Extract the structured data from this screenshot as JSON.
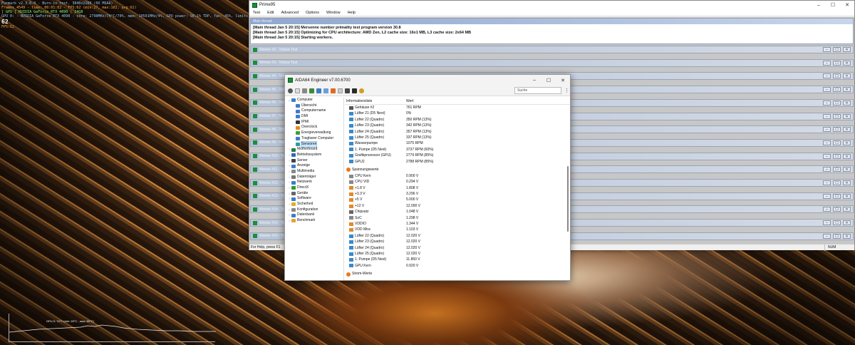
{
  "osd": {
    "line1": "Furmark v2.3.0.0 - Burn-in test, 3840x2160 (0X MSAA)",
    "line2": "Frames 4549 - time: 00:01:02 - FPS:62 (min:27, max:102, avg:62)",
    "line3": "[ GPU ] NVIDIA GeForce RTX 4090 | 24GB",
    "line4": "GPU 0: - NVIDIA GeForce RTX 4090 - core: 2790MHz/74°C/70%, mem: 10501MHz/4%, GPU power: 98.1% TDP, fan: 45%, limits:[power:0, temp:0, volt:0, OV:0]",
    "big": "62",
    "sub": "FPS:62",
    "graph": "GPU 0: 74°C (min: 28°C - max: 80°C)"
  },
  "prime": {
    "title": "Prime95",
    "menu": [
      "Test",
      "Edit",
      "Advanced",
      "Options",
      "Window",
      "Help"
    ],
    "main_title": "Main thread",
    "log": [
      "[Main thread Jan 5 20:15] Mersenne number primality test program version 30.8",
      "[Main thread Jan 5 20:15] Optimizing for CPU architecture: AMD Zen, L2 cache size: 16x1 MB, L3 cache size: 2x64 MB",
      "[Main thread Jan 5 20:15] Starting workers."
    ],
    "workers": [
      "Worker #2 - Torture Test",
      "Worker #3 - Torture Test",
      "Worker #4 - Torture Test",
      "Worker #5 - Torture Test",
      "Worker #6 - Torture Test",
      "Worker #7 - Torture Test",
      "Worker #8 - Torture Test",
      "Worker #9 - Torture Test",
      "Worker #10 - Torture Test",
      "Worker #11 - Torture Test",
      "Worker #12 - Torture Test",
      "Worker #13 - Torture Test",
      "Worker #14 - Torture Test",
      "Worker #15 - Torture Test",
      "Worker #16 - Torture Test"
    ],
    "status": "For Help, press F1",
    "num": "NUM"
  },
  "aida": {
    "title": "AIDA64 Engineer v7.00.6700",
    "search": "Suche",
    "col1": "Informationsliste",
    "col2": "Wert",
    "tree": [
      {
        "label": "Computer",
        "lvl": 0,
        "arrow": "⌄",
        "color": "#3d7cc9"
      },
      {
        "label": "Übersicht",
        "lvl": 1,
        "color": "#3d7cc9"
      },
      {
        "label": "Computername",
        "lvl": 1,
        "color": "#3d7cc9"
      },
      {
        "label": "DMI",
        "lvl": 1,
        "color": "#3d7cc9"
      },
      {
        "label": "IPMI",
        "lvl": 1,
        "color": "#333"
      },
      {
        "label": "Overclock",
        "lvl": 1,
        "color": "#e88a1a"
      },
      {
        "label": "Energieverwaltung",
        "lvl": 1,
        "color": "#3aa03a"
      },
      {
        "label": "Tragbarer Computer",
        "lvl": 1,
        "color": "#3d7cc9"
      },
      {
        "label": "Sensoren",
        "lvl": 1,
        "color": "#28a0a0",
        "sel": true
      },
      {
        "label": "Motherboard",
        "lvl": 0,
        "arrow": "›",
        "color": "#2a7a4a"
      },
      {
        "label": "Betriebssystem",
        "lvl": 0,
        "arrow": "›",
        "color": "#2a68c9"
      },
      {
        "label": "Server",
        "lvl": 0,
        "arrow": "›",
        "color": "#444"
      },
      {
        "label": "Anzeige",
        "lvl": 0,
        "arrow": "›",
        "color": "#3d7cc9"
      },
      {
        "label": "Multimedia",
        "lvl": 0,
        "arrow": "›",
        "color": "#888"
      },
      {
        "label": "Datenträger",
        "lvl": 0,
        "arrow": "›",
        "color": "#777"
      },
      {
        "label": "Netzwerk",
        "lvl": 0,
        "arrow": "›",
        "color": "#3d7cc9"
      },
      {
        "label": "DirectX",
        "lvl": 0,
        "arrow": "›",
        "color": "#2aa02a"
      },
      {
        "label": "Geräte",
        "lvl": 0,
        "arrow": "›",
        "color": "#666"
      },
      {
        "label": "Software",
        "lvl": 0,
        "arrow": "›",
        "color": "#3d7cc9"
      },
      {
        "label": "Sicherheit",
        "lvl": 0,
        "arrow": "›",
        "color": "#e0b020"
      },
      {
        "label": "Konfiguration",
        "lvl": 0,
        "arrow": "›",
        "color": "#888"
      },
      {
        "label": "Datenbank",
        "lvl": 0,
        "arrow": "›",
        "color": "#3d7cc9"
      },
      {
        "label": "Benchmark",
        "lvl": 0,
        "arrow": "›",
        "color": "#e8a030"
      }
    ],
    "rows_top": [
      {
        "name": "Gehäuse #2",
        "value": "761 RPM",
        "color": "#555"
      },
      {
        "name": "Lüfter 21 (D5 Next)",
        "value": "0%",
        "color": "#3a8ac9"
      },
      {
        "name": "Lüfter 22 (Quadro)",
        "value": "350 RPM  (13%)",
        "color": "#3a8ac9"
      },
      {
        "name": "Lüfter 23 (Quadro)",
        "value": "342 RPM  (13%)",
        "color": "#3a8ac9"
      },
      {
        "name": "Lüfter 24 (Quadro)",
        "value": "357 RPM  (13%)",
        "color": "#3a8ac9"
      },
      {
        "name": "Lüfter 25 (Quadro)",
        "value": "337 RPM  (13%)",
        "color": "#3a8ac9"
      },
      {
        "name": "Wasserpumpe",
        "value": "1075 RPM",
        "color": "#3a8ac9"
      },
      {
        "name": "1. Pumpe (D5 Next)",
        "value": "3737 RPM  (60%)",
        "color": "#3a8ac9"
      },
      {
        "name": "Grafikprozessor (GPU)",
        "value": "2779 RPM  (85%)",
        "color": "#3a8ac9"
      },
      {
        "name": "GPU2",
        "value": "2788 RPM  (85%)",
        "color": "#3a8ac9"
      }
    ],
    "section_volt": "Spannungswerte",
    "rows_volt": [
      {
        "name": "CPU Kern",
        "value": "0.900 V",
        "color": "#888"
      },
      {
        "name": "CPU VID",
        "value": "0.294 V",
        "color": "#888"
      },
      {
        "name": "+1.8 V",
        "value": "1.808 V",
        "color": "#e08a2a"
      },
      {
        "name": "+3.3 V",
        "value": "3.296 V",
        "color": "#e08a2a"
      },
      {
        "name": "+5 V",
        "value": "5.000 V",
        "color": "#e08a2a"
      },
      {
        "name": "+12 V",
        "value": "12.000 V",
        "color": "#e08a2a"
      },
      {
        "name": "Chipsatz",
        "value": "1.048 V",
        "color": "#666"
      },
      {
        "name": "SoC",
        "value": "1.298 V",
        "color": "#888"
      },
      {
        "name": "VDDIO",
        "value": "1.344 V",
        "color": "#e08a2a"
      },
      {
        "name": "VDD Misc",
        "value": "1.103 V",
        "color": "#e08a2a"
      },
      {
        "name": "Lüfter 22 (Quadro)",
        "value": "12.020 V",
        "color": "#3a8ac9"
      },
      {
        "name": "Lüfter 23 (Quadro)",
        "value": "12.020 V",
        "color": "#3a8ac9"
      },
      {
        "name": "Lüfter 24 (Quadro)",
        "value": "12.020 V",
        "color": "#3a8ac9"
      },
      {
        "name": "Lüfter 25 (Quadro)",
        "value": "12.020 V",
        "color": "#3a8ac9"
      },
      {
        "name": "1. Pumpe (D5 Next)",
        "value": "11.850 V",
        "color": "#3a8ac9"
      },
      {
        "name": "GPU Kern",
        "value": "0.920 V",
        "color": "#3a8ac9"
      }
    ],
    "section_power": "Strom-Werte"
  }
}
